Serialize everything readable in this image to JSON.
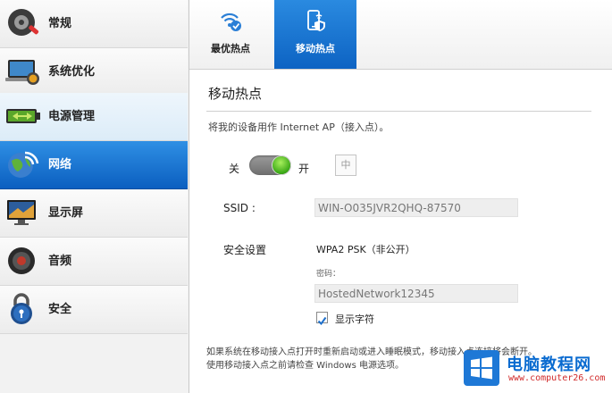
{
  "sidebar": {
    "items": [
      {
        "label": "常规",
        "icon": "gear-icon"
      },
      {
        "label": "系统优化",
        "icon": "laptop-gauge-icon"
      },
      {
        "label": "电源管理",
        "icon": "battery-icon"
      },
      {
        "label": "网络",
        "icon": "globe-wifi-icon"
      },
      {
        "label": "显示屏",
        "icon": "monitor-icon"
      },
      {
        "label": "音频",
        "icon": "speaker-icon"
      },
      {
        "label": "安全",
        "icon": "padlock-icon"
      }
    ],
    "active_index": 3
  },
  "tabs": [
    {
      "label": "最优热点",
      "icon": "wifi-check-icon"
    },
    {
      "label": "移动热点",
      "icon": "phone-hotspot-icon"
    }
  ],
  "main": {
    "title": "移动热点",
    "description": "将我的设备用作 Internet AP（接入点）。",
    "toggle": {
      "off_label": "关",
      "on_label": "开",
      "state": "on"
    },
    "ime_label": "中",
    "ssid_label": "SSID :",
    "ssid_value": "WIN-O035JVR2QHQ-87570",
    "security_label": "安全设置",
    "security_value": "WPA2 PSK（非公开）",
    "password_label": "密码：",
    "password_value": "HostedNetwork12345",
    "show_chars_label": "显示字符",
    "show_chars_checked": true,
    "note_line1": "如果系统在移动接入点打开时重新启动或进入睡眠模式，移动接入点连接将会断开。",
    "note_line2": "使用移动接入点之前请检查 Windows 电源选项。"
  },
  "watermark": {
    "title": "电脑教程网",
    "url": "www.computer26.com"
  },
  "colors": {
    "accent_blue": "#1b74d4",
    "toggle_green": "#3aa816"
  }
}
